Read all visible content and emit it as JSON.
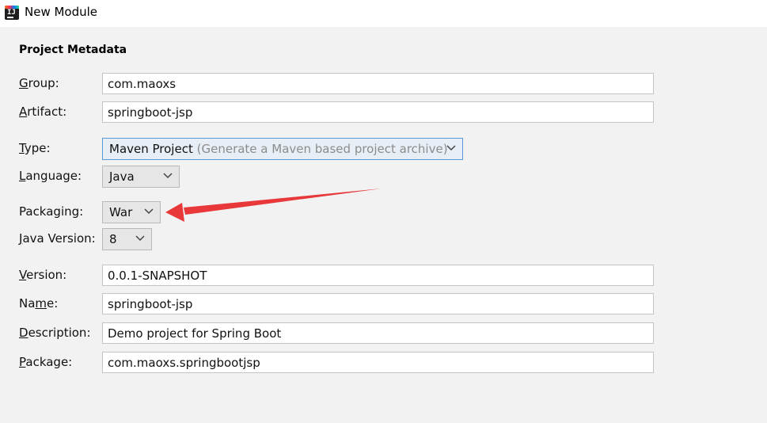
{
  "window": {
    "title": "New Module",
    "icon": "intellij-idea-icon"
  },
  "section_title": "Project Metadata",
  "fields": {
    "group": {
      "label_mnemonic": "G",
      "label_rest": "roup:",
      "value": "com.maoxs"
    },
    "artifact": {
      "label_mnemonic": "A",
      "label_rest": "rtifact:",
      "value": "springboot-jsp"
    },
    "type": {
      "label_mnemonic": "T",
      "label_rest": "ype:",
      "value": "Maven Project",
      "hint": "(Generate a Maven based project archive)"
    },
    "language": {
      "label_mnemonic": "L",
      "label_rest": "anguage:",
      "value": "Java"
    },
    "packaging": {
      "label": "Packaging:",
      "value": "War"
    },
    "java_version": {
      "label_mnemonic": "J",
      "label_rest": "ava Version:",
      "value": "8"
    },
    "version": {
      "label_mnemonic": "V",
      "label_rest": "ersion:",
      "value": "0.0.1-SNAPSHOT"
    },
    "name": {
      "label_pre": "Na",
      "label_mnemonic": "m",
      "label_rest": "e:",
      "value": "springboot-jsp"
    },
    "description": {
      "label_mnemonic": "D",
      "label_rest": "escription:",
      "value": "Demo project for Spring Boot"
    },
    "package": {
      "label_mnemonic": "P",
      "label_rest": "ackage:",
      "value": "com.maoxs.springbootjsp"
    }
  },
  "colors": {
    "annotation_arrow": "#e8383a",
    "focus_border": "#5a9ad6"
  }
}
